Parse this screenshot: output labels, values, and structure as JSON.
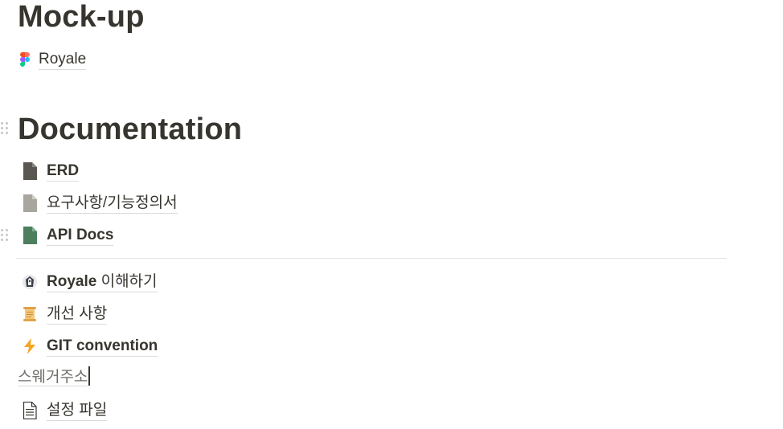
{
  "sections": {
    "mockup_title": "Mock-up",
    "documentation_title": "Documentation"
  },
  "mockup": {
    "items": [
      {
        "label": "Royale",
        "icon": "figma-icon"
      }
    ]
  },
  "documentation": {
    "items": [
      {
        "label": "ERD",
        "icon": "page-icon-dark",
        "color": "#5a5753"
      },
      {
        "label": "요구사항/기능정의서",
        "icon": "page-icon-gray",
        "color": "#a9a6a0"
      },
      {
        "label": "API Docs",
        "icon": "page-icon-green",
        "color": "#4b7f5e"
      }
    ]
  },
  "links": {
    "royale_strong": "Royale",
    "royale_rest": " 이해하기",
    "improvements": "개선 사항",
    "git": "GIT convention",
    "settings": "설정 파일"
  },
  "editing_text": "스웨거주소",
  "colors": {
    "text": "#37352f",
    "underline": "#dcdbd8",
    "divider": "#e3e2e0"
  }
}
